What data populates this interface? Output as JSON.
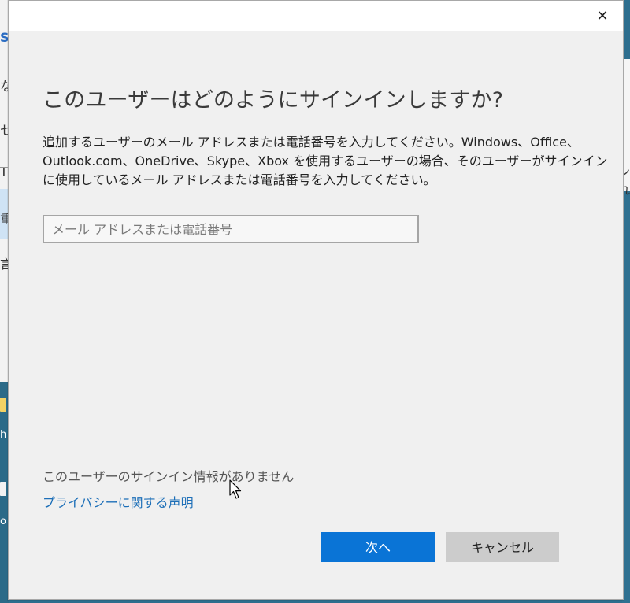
{
  "dialog": {
    "heading": "このユーザーはどのようにサインインしますか?",
    "description_lines": [
      "追加するユーザーのメール アドレスまたは電話番号を入力してください。Windows、Office、",
      "Outlook.com、OneDrive、Skype、Xbox を使用するユーザーの場合、そのユーザーがサインイン",
      "に使用しているメール アドレスまたは電話番号を入力してください。"
    ],
    "email_placeholder": "メール アドレスまたは電話番号",
    "email_value": "",
    "no_signin_text": "このユーザーのサインイン情報がありません",
    "privacy_link": "プライバシーに関する声明",
    "next_button": "次へ",
    "cancel_button": "キャンセル",
    "close_glyph": "✕"
  },
  "background": {
    "left_chars": [
      "S",
      "な",
      "セ",
      "T",
      "重",
      "言"
    ],
    "right_chars": [
      "ン",
      "れ"
    ],
    "desktop_char": "h",
    "desktop_char2": "o"
  },
  "colors": {
    "accent": "#0a74d6",
    "link": "#1d6fb8",
    "desktop": "#2d6e8e"
  }
}
